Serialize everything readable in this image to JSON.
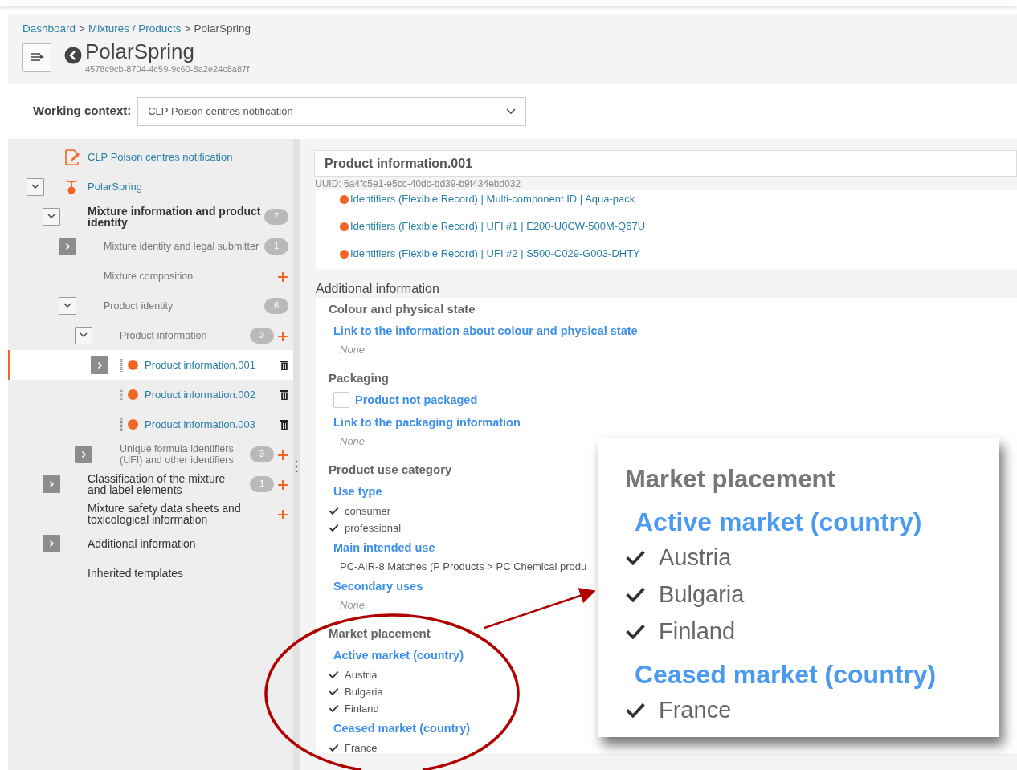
{
  "breadcrumb": [
    {
      "label": "Dashboard",
      "kind": "link"
    },
    {
      "label": ">",
      "kind": "separator"
    },
    {
      "label": "Mixtures / Products",
      "kind": "link"
    },
    {
      "label": ">",
      "kind": "separator"
    },
    {
      "label": "PolarSpring",
      "kind": "current"
    }
  ],
  "header": {
    "title": "PolarSpring",
    "uuid": "4578c9cb-8704-4c59-9c60-8a2e24c8a87f"
  },
  "working_context": {
    "label": "Working context:",
    "value": "CLP Poison centres notification"
  },
  "sidebar": {
    "tree": [
      {
        "label": "CLP Poison centres notification",
        "kind": "context",
        "selected": false
      },
      {
        "label": "PolarSpring",
        "kind": "root",
        "selected": false,
        "expanded": true,
        "children": [
          {
            "label": "Mixture information and product identity",
            "kind": "section",
            "selected": false,
            "expanded": true,
            "badge": "7",
            "children": [
              {
                "label": "Mixture identity and legal submitter",
                "kind": "group",
                "selected": false,
                "expanded": false,
                "badge": "1"
              },
              {
                "label": "Mixture composition",
                "kind": "group",
                "selected": false,
                "can_add": true
              },
              {
                "label": "Product identity",
                "kind": "group",
                "selected": false,
                "expanded": true,
                "badge": "6",
                "children": [
                  {
                    "label": "Product information",
                    "kind": "group",
                    "selected": false,
                    "expanded": true,
                    "badge": "3",
                    "can_add": true,
                    "children": [
                      {
                        "label": "Product information.001",
                        "kind": "record",
                        "selected": true,
                        "expanded": false
                      },
                      {
                        "label": "Product information.002",
                        "kind": "record",
                        "selected": false
                      },
                      {
                        "label": "Product information.003",
                        "kind": "record",
                        "selected": false
                      }
                    ]
                  },
                  {
                    "label": "Unique formula identifiers (UFI) and other identifiers",
                    "kind": "group",
                    "selected": false,
                    "expanded": false,
                    "badge": "3",
                    "can_add": true
                  }
                ]
              }
            ]
          },
          {
            "label": "Classification of the mixture and label elements",
            "kind": "section",
            "selected": false,
            "expanded": false,
            "badge": "1",
            "can_add": true
          },
          {
            "label": "Mixture safety data sheets and toxicological information",
            "kind": "section",
            "selected": false,
            "can_add": true
          },
          {
            "label": "Additional information",
            "kind": "section",
            "selected": false,
            "expanded": false
          },
          {
            "label": "Inherited templates",
            "kind": "section",
            "selected": false
          }
        ]
      }
    ]
  },
  "record": {
    "title": "Product information.001",
    "uuid": "UUID: 6a4fc5e1-e5cc-40dc-bd39-b9f434ebd032",
    "identifiers": [
      "Identifiers (Flexible Record) | Multi-component ID | Aqua-pack",
      "Identifiers (Flexible Record) | UFI #1 | E200-U0CW-500M-Q67U",
      "Identifiers (Flexible Record) | UFI #2 | S500-C029-G003-DHTY"
    ],
    "section_title": "Additional information",
    "groups": [
      {
        "heading": "Colour and physical state",
        "fields": [
          {
            "kind": "empty",
            "label": "Link to the information about colour and physical state",
            "value": "None"
          }
        ]
      },
      {
        "heading": "Packaging",
        "fields": [
          {
            "kind": "checkbox",
            "label": "Product not packaged",
            "checked": false
          },
          {
            "kind": "empty",
            "label": "Link to the packaging information",
            "value": "None"
          }
        ]
      },
      {
        "heading": "Product use category",
        "fields": [
          {
            "kind": "values",
            "label": "Use type",
            "items": [
              "consumer",
              "professional"
            ]
          },
          {
            "kind": "text",
            "label": "Main intended use",
            "value": "PC-AIR-8 Matches (P Products > PC Chemical produ"
          },
          {
            "kind": "empty",
            "label": "Secondary uses",
            "value": "None"
          }
        ]
      },
      {
        "heading": "Market placement",
        "fields": [
          {
            "kind": "values",
            "label": "Active market (country)",
            "items": [
              "Austria",
              "Bulgaria",
              "Finland"
            ]
          },
          {
            "kind": "values",
            "label": "Ceased market (country)",
            "items": [
              "France"
            ]
          }
        ]
      }
    ]
  },
  "zoom_inset": {
    "title": "Market placement",
    "fields": [
      {
        "label": "Active market (country)",
        "items": [
          "Austria",
          "Bulgaria",
          "Finland"
        ]
      },
      {
        "label": "Ceased market (country)",
        "items": [
          "France"
        ]
      }
    ]
  }
}
